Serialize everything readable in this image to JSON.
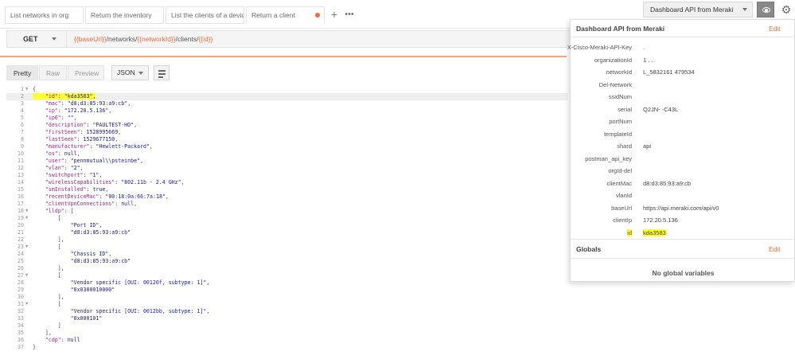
{
  "tabs": [
    {
      "label": "List networks in org"
    },
    {
      "label": "Return the inventory"
    },
    {
      "label": "List the clients of a device,"
    },
    {
      "label": "Return a client"
    }
  ],
  "env_select": {
    "label": "Dashboard API from Meraki"
  },
  "request": {
    "method": "GET",
    "url_parts": {
      "base": "{{baseUrl}}",
      "p1": "/networks/",
      "net": "{{networkId}}",
      "p2": "/clients/",
      "id": "{{id}}"
    }
  },
  "response_view": {
    "pretty": "Pretty",
    "raw": "Raw",
    "preview": "Preview",
    "format": "JSON"
  },
  "code_lines": [
    {
      "n": "1",
      "fold": "▼",
      "text": "{"
    },
    {
      "n": "2",
      "fold": "",
      "text": "    \"id\": \"kda3583\","
    },
    {
      "n": "3",
      "fold": "",
      "text": "    \"mac\": \"d8:d3:85:93:a9:cb\","
    },
    {
      "n": "4",
      "fold": "",
      "text": "    \"ip\": \"172.20.5.136\","
    },
    {
      "n": "5",
      "fold": "",
      "text": "    \"ip6\": \"\","
    },
    {
      "n": "6",
      "fold": "",
      "text": "    \"description\": \"PAULTEST-HO\","
    },
    {
      "n": "7",
      "fold": "",
      "text": "    \"firstSeen\": 1528995669,"
    },
    {
      "n": "8",
      "fold": "",
      "text": "    \"lastSeen\": 1529677150,"
    },
    {
      "n": "9",
      "fold": "",
      "text": "    \"manufacturer\": \"Hewlett-Packard\","
    },
    {
      "n": "10",
      "fold": "",
      "text": "    \"os\": null,"
    },
    {
      "n": "11",
      "fold": "",
      "text": "    \"user\": \"pennmutual\\\\psteinbe\","
    },
    {
      "n": "12",
      "fold": "",
      "text": "    \"vlan\": \"2\","
    },
    {
      "n": "13",
      "fold": "",
      "text": "    \"switchport\": \"1\","
    },
    {
      "n": "14",
      "fold": "",
      "text": "    \"wirelessCapabilities\": \"802.11b - 2.4 GHz\","
    },
    {
      "n": "15",
      "fold": "",
      "text": "    \"smInstalled\": true,"
    },
    {
      "n": "16",
      "fold": "",
      "text": "    \"recentDeviceMac\": \"00:18:0a:66:7a:18\","
    },
    {
      "n": "17",
      "fold": "",
      "text": "    \"clientVpnConnections\": null,"
    },
    {
      "n": "18",
      "fold": "▼",
      "text": "    \"lldp\": ["
    },
    {
      "n": "19",
      "fold": "▼",
      "text": "        ["
    },
    {
      "n": "20",
      "fold": "",
      "text": "            \"Port ID\","
    },
    {
      "n": "21",
      "fold": "",
      "text": "            \"d8:d3:85:93:a9:cb\""
    },
    {
      "n": "22",
      "fold": "",
      "text": "        ],"
    },
    {
      "n": "23",
      "fold": "▼",
      "text": "        ["
    },
    {
      "n": "24",
      "fold": "",
      "text": "            \"Chassis ID\","
    },
    {
      "n": "25",
      "fold": "",
      "text": "            \"d8:d3:85:93:a9:cb\""
    },
    {
      "n": "26",
      "fold": "",
      "text": "        ],"
    },
    {
      "n": "27",
      "fold": "▼",
      "text": "        ["
    },
    {
      "n": "28",
      "fold": "",
      "text": "            \"Vendor specific [OUI: 00120f, subtype: 1]\","
    },
    {
      "n": "29",
      "fold": "",
      "text": "            \"0x0300010000\""
    },
    {
      "n": "30",
      "fold": "",
      "text": "        ],"
    },
    {
      "n": "31",
      "fold": "▼",
      "text": "        ["
    },
    {
      "n": "32",
      "fold": "",
      "text": "            \"Vendor specific [OUI: 0012bb, subtype: 1]\","
    },
    {
      "n": "33",
      "fold": "",
      "text": "            \"0x000101\""
    },
    {
      "n": "34",
      "fold": "",
      "text": "        ]"
    },
    {
      "n": "35",
      "fold": "",
      "text": "    ],"
    },
    {
      "n": "36",
      "fold": "",
      "text": "    \"cdp\": null"
    },
    {
      "n": "37",
      "fold": "",
      "text": "}"
    }
  ],
  "env_panel": {
    "title": "Dashboard API from Meraki",
    "edit_label": "Edit",
    "variables": [
      {
        "key": "X-Cisco-Meraki-API-Key",
        "value": "."
      },
      {
        "key": "organizationId",
        "value": "1 . ."
      },
      {
        "key": "networkId",
        "value": "L_5832161        479534"
      },
      {
        "key": "Del-Network",
        "value": ""
      },
      {
        "key": "ssidNum",
        "value": ""
      },
      {
        "key": "serial",
        "value": "Q2JN-          -C43L"
      },
      {
        "key": "portNum",
        "value": ""
      },
      {
        "key": "templateId",
        "value": ""
      },
      {
        "key": "shard",
        "value": "api"
      },
      {
        "key": "postman_api_key",
        "value": ""
      },
      {
        "key": "orgId-del",
        "value": ""
      },
      {
        "key": "clientMac",
        "value": "d8:d3:85:93:a9:cb"
      },
      {
        "key": "vlanId",
        "value": ""
      },
      {
        "key": "baseUrl",
        "value": "https://api.meraki.com/api/v0"
      },
      {
        "key": "clientIp",
        "value": "172.20.5.136"
      },
      {
        "key": "id",
        "value": "kda3583"
      }
    ],
    "globals_title": "Globals",
    "globals_edit_label": "Edit",
    "no_globals": "No global variables"
  },
  "colors": {
    "accent": "#f26b3a",
    "highlight": "#ffff2e"
  }
}
